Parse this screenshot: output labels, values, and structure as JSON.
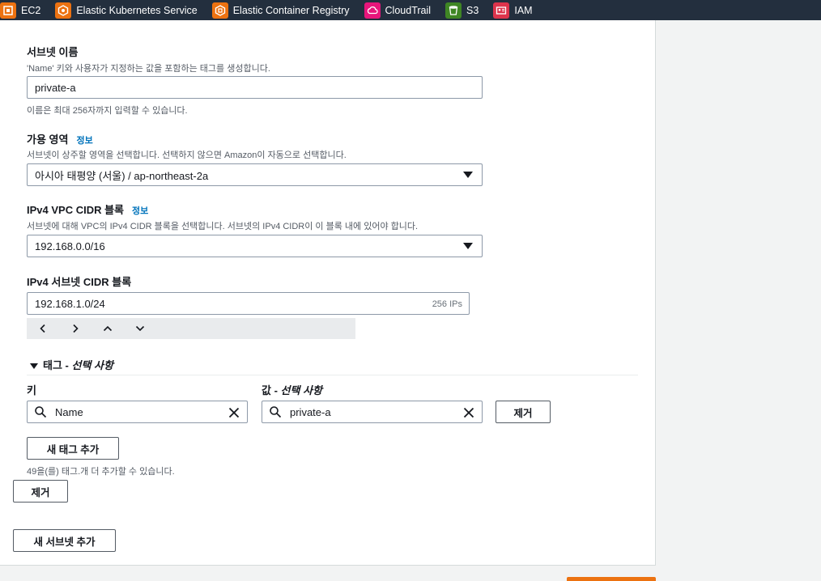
{
  "topbar": {
    "services": [
      {
        "label": "EC2",
        "icon": "ec2-icon",
        "color": "#ec7211"
      },
      {
        "label": "Elastic Kubernetes Service",
        "icon": "eks-icon",
        "color": "#ec7211"
      },
      {
        "label": "Elastic Container Registry",
        "icon": "ecr-icon",
        "color": "#ec7211"
      },
      {
        "label": "CloudTrail",
        "icon": "cloudtrail-icon",
        "color": "#e7157b"
      },
      {
        "label": "S3",
        "icon": "s3-icon",
        "color": "#3f8624"
      },
      {
        "label": "IAM",
        "icon": "iam-icon",
        "color": "#dd344c"
      }
    ]
  },
  "form": {
    "subnet_name": {
      "label": "서브넷 이름",
      "description": "'Name' 키와 사용자가 지정하는 값을 포함하는 태그를 생성합니다.",
      "value": "private-a",
      "hint": "이름은 최대 256자까지 입력할 수 있습니다."
    },
    "availability_zone": {
      "label": "가용 영역",
      "info": "정보",
      "description": "서브넷이 상주할 영역을 선택합니다. 선택하지 않으면 Amazon이 자동으로 선택합니다.",
      "value": "아시아 태평양 (서울) / ap-northeast-2a"
    },
    "vpc_cidr": {
      "label": "IPv4 VPC CIDR 블록",
      "info": "정보",
      "description": "서브넷에 대해 VPC의 IPv4 CIDR 블록을 선택합니다. 서브넷의 IPv4 CIDR이 이 블록 내에 있어야 합니다.",
      "value": "192.168.0.0/16"
    },
    "subnet_cidr": {
      "label": "IPv4 서브넷 CIDR 블록",
      "value": "192.168.1.0/24",
      "suffix": "256 IPs"
    },
    "tags": {
      "header": "태그 -",
      "header_optional": "선택 사항",
      "key_label": "키",
      "value_label": "값 -",
      "value_optional": "선택 사항",
      "key_value": "Name",
      "value_value": "private-a",
      "remove_label": "제거",
      "add_label": "새 태그 추가",
      "remaining_text": "49을(를) 태그.개 더 추가할 수 있습니다."
    },
    "remove_subnet_label": "제거",
    "add_subnet_label": "새 서브넷 추가"
  },
  "colors": {
    "topbar": "#232f3e",
    "link": "#0073bb",
    "primary": "#ec7211"
  }
}
